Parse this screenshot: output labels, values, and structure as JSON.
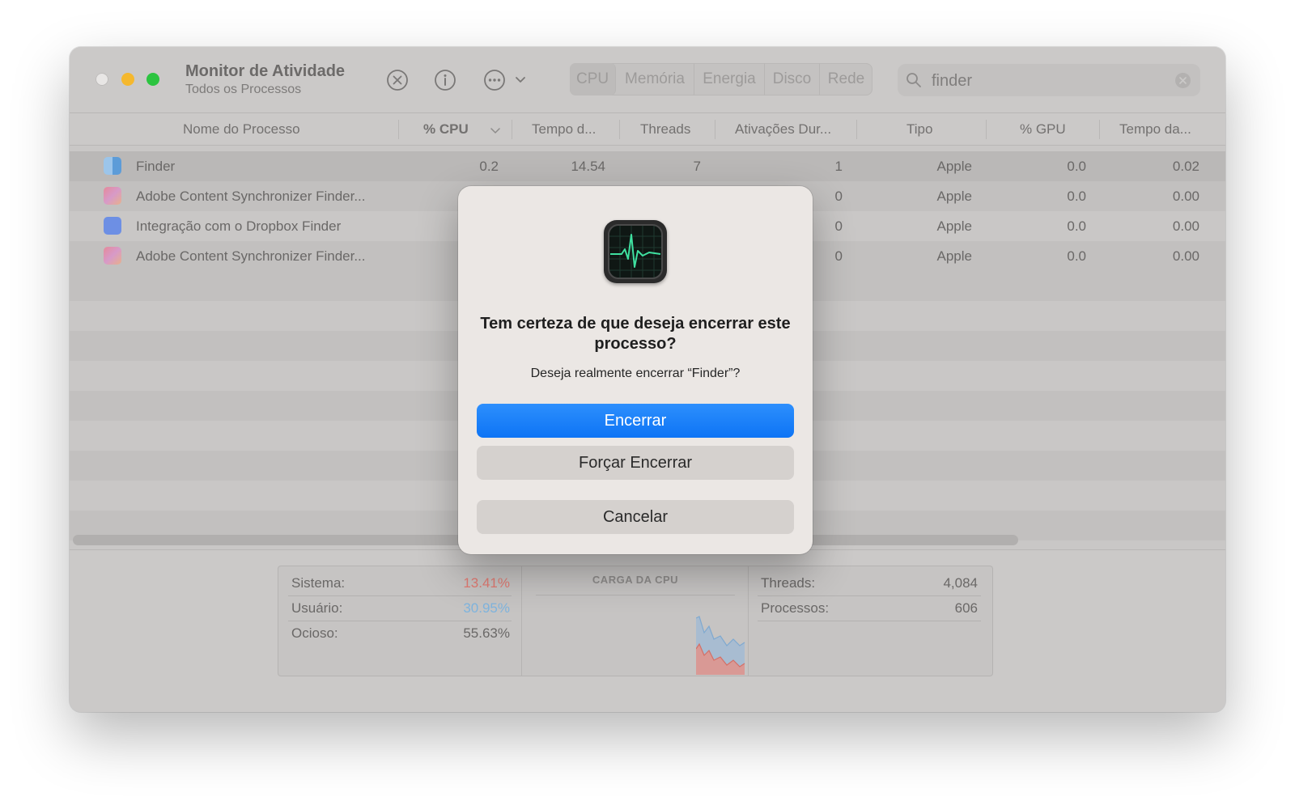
{
  "window": {
    "title": "Monitor de Atividade",
    "subtitle": "Todos os Processos"
  },
  "toolbar": {
    "stop_icon": "stop-process-icon",
    "info_icon": "info-icon",
    "more_icon": "more-options-icon",
    "tabs": [
      "CPU",
      "Memória",
      "Energia",
      "Disco",
      "Rede"
    ],
    "active_tab": "CPU"
  },
  "search": {
    "value": "finder",
    "icon": "search-icon",
    "clear_icon": "clear-icon"
  },
  "table": {
    "columns": [
      "Nome do Processo",
      "% CPU",
      "Tempo d...",
      "Threads",
      "Ativações Dur...",
      "Tipo",
      "% GPU",
      "Tempo da..."
    ],
    "sorted_column": "% CPU",
    "rows": [
      {
        "name": "Finder",
        "cpu": "0.2",
        "time": "14.54",
        "threads": "7",
        "wakeups": "1",
        "type": "Apple",
        "gpu": "0.0",
        "gpu_time": "0.02",
        "icon": "finder-icon"
      },
      {
        "name": "Adobe Content Synchronizer Finder...",
        "cpu": "",
        "time": "",
        "threads": "",
        "wakeups": "0",
        "type": "Apple",
        "gpu": "0.0",
        "gpu_time": "0.00",
        "icon": "adobe-cc-icon"
      },
      {
        "name": "Integração com o Dropbox Finder",
        "cpu": "",
        "time": "",
        "threads": "",
        "wakeups": "0",
        "type": "Apple",
        "gpu": "0.0",
        "gpu_time": "0.00",
        "icon": "dropbox-icon"
      },
      {
        "name": "Adobe Content Synchronizer Finder...",
        "cpu": "",
        "time": "",
        "threads": "",
        "wakeups": "0",
        "type": "Apple",
        "gpu": "0.0",
        "gpu_time": "0.00",
        "icon": "adobe-cc-icon"
      }
    ]
  },
  "stats": {
    "system_label": "Sistema:",
    "system_value": "13.41%",
    "user_label": "Usuário:",
    "user_value": "30.95%",
    "idle_label": "Ocioso:",
    "idle_value": "55.63%",
    "graph_title": "CARGA DA CPU",
    "threads_label": "Threads:",
    "threads_value": "4,084",
    "processes_label": "Processos:",
    "processes_value": "606",
    "system_color": "#e07a72",
    "user_color": "#7fb4de"
  },
  "dialog": {
    "icon": "activity-monitor-icon",
    "title": "Tem certeza de que deseja encerrar este processo?",
    "message": "Deseja realmente encerrar “Finder”?",
    "quit_label": "Encerrar",
    "force_quit_label": "Forçar Encerrar",
    "cancel_label": "Cancelar",
    "accent_color": "#1a7ef8"
  }
}
